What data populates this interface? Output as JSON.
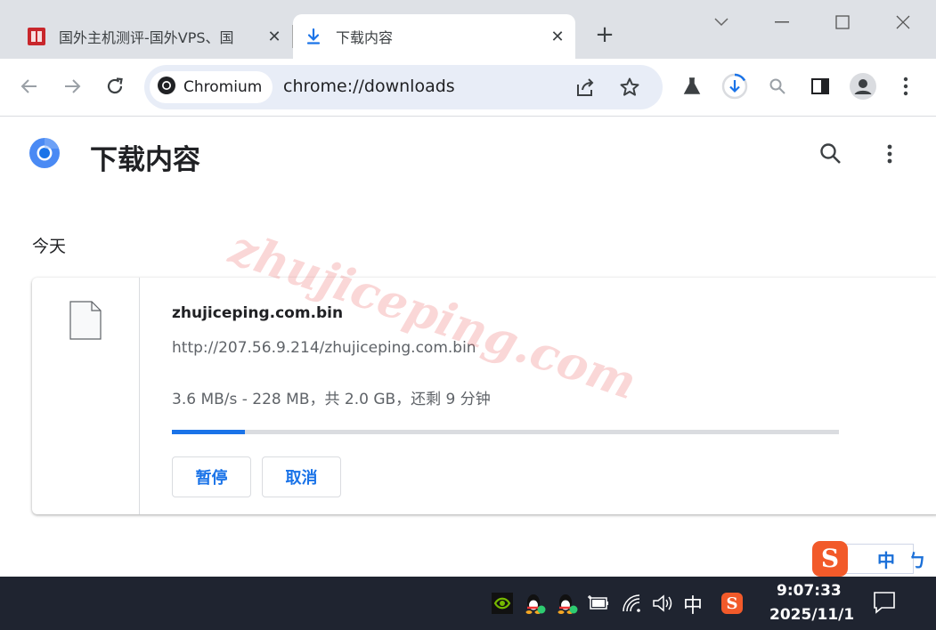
{
  "browser": {
    "tabs": [
      {
        "title": "国外主机测评-国外VPS、国",
        "favicon": "site-favicon",
        "active": false
      },
      {
        "title": "下载内容",
        "favicon": "download-icon",
        "active": true
      }
    ],
    "omnibox": {
      "chip_label": "Chromium",
      "url": "chrome://downloads"
    }
  },
  "page": {
    "title": "下载内容",
    "date_group": "今天",
    "watermark": "zhujiceping.com"
  },
  "download": {
    "file_name": "zhujiceping.com.bin",
    "url": "http://207.56.9.214/zhujiceping.com.bin",
    "status": "3.6 MB/s - 228 MB，共 2.0 GB，还剩 9 分钟",
    "progress_fraction": 0.11,
    "pause_label": "暂停",
    "cancel_label": "取消"
  },
  "ime": {
    "logo": "S",
    "mode": "中",
    "width_mode": "ㄅ"
  },
  "taskbar": {
    "input_language": "中",
    "time": "9:07:33",
    "date": "2025/11/1"
  },
  "colors": {
    "accent": "#1a73e8",
    "tabstrip": "#dee1e6",
    "omnibox": "#e8edf7",
    "taskbar": "#1f2430",
    "ime_brand": "#f25a2a"
  }
}
